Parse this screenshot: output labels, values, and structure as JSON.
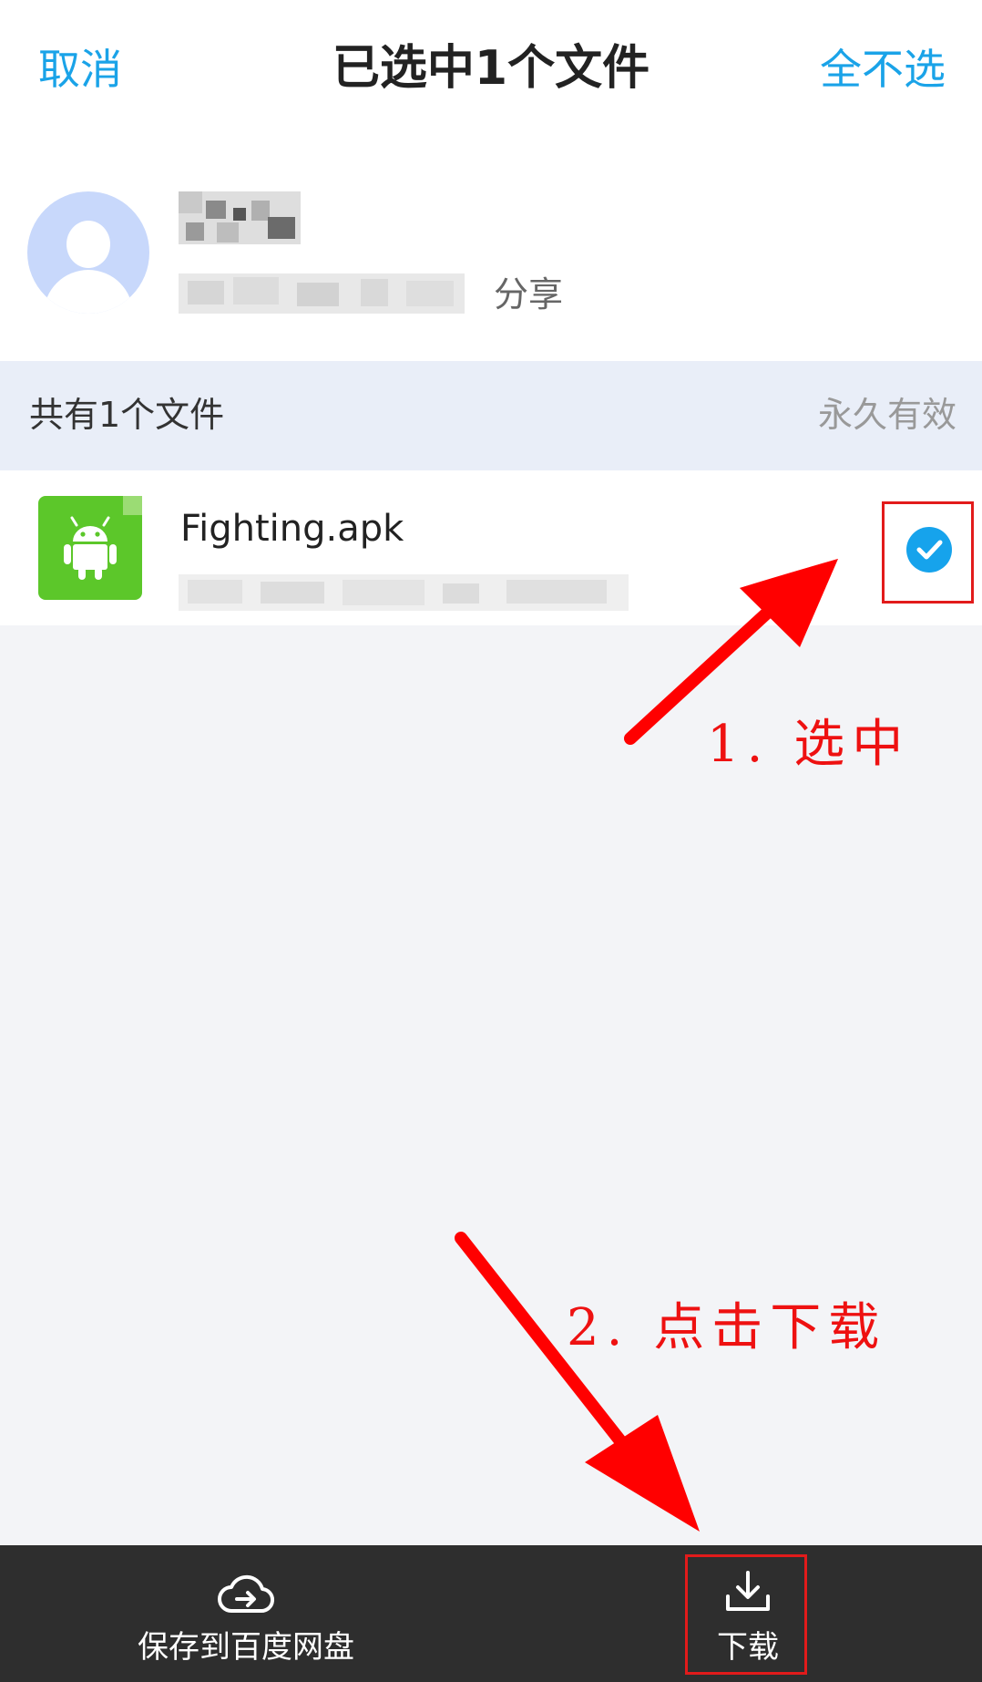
{
  "header": {
    "cancel_label": "取消",
    "title": "已选中1个文件",
    "deselect_all_label": "全不选"
  },
  "sharer": {
    "share_label": "分享"
  },
  "section": {
    "file_count_label": "共有1个文件",
    "validity_label": "永久有效"
  },
  "file": {
    "name": "Fighting.apk",
    "selected": true,
    "icon": "android-apk-icon"
  },
  "annotations": {
    "step1": "1. 选中",
    "step2": "2. 点击下载"
  },
  "bottom_bar": {
    "save_label": "保存到百度网盘",
    "download_label": "下载"
  },
  "colors": {
    "accent": "#1aa3e8",
    "annotation_red": "#e21b1b",
    "file_icon_green": "#5cc72a",
    "bottom_bar": "#2e2e2e"
  }
}
